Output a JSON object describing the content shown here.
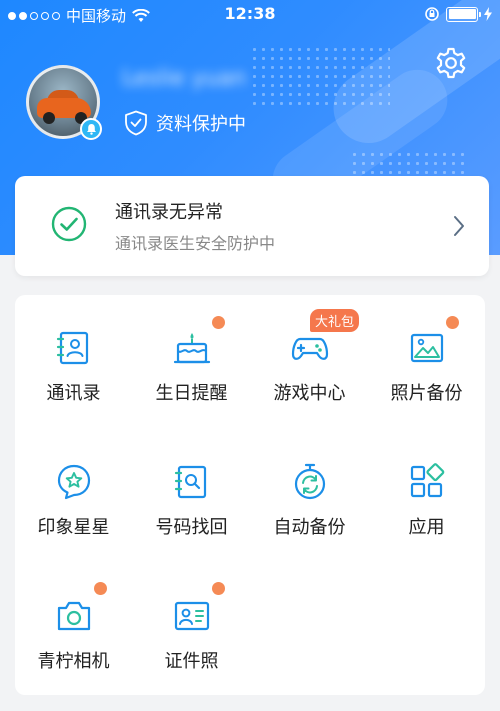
{
  "status_bar": {
    "carrier": "中国移动",
    "time": "12:38"
  },
  "profile": {
    "username": "Leslie yuan",
    "protect_text": "资料保护中"
  },
  "contact_card": {
    "title": "通讯录无异常",
    "subtitle": "通讯录医生安全防护中"
  },
  "grid": {
    "items": [
      {
        "label": "通讯录",
        "icon": "contacts-icon"
      },
      {
        "label": "生日提醒",
        "icon": "birthday-cake-icon",
        "dot": true
      },
      {
        "label": "游戏中心",
        "icon": "gamepad-icon",
        "badge": "大礼包"
      },
      {
        "label": "照片备份",
        "icon": "photo-icon",
        "dot": true
      },
      {
        "label": "印象星星",
        "icon": "star-chat-icon"
      },
      {
        "label": "号码找回",
        "icon": "number-search-icon"
      },
      {
        "label": "自动备份",
        "icon": "auto-backup-icon"
      },
      {
        "label": "应用",
        "icon": "apps-icon"
      },
      {
        "label": "青柠相机",
        "icon": "camera-icon",
        "dot": true
      },
      {
        "label": "证件照",
        "icon": "id-card-icon",
        "dot": true
      }
    ]
  },
  "colors": {
    "accent": "#1e88ff",
    "icon_blue": "#1c8fe8",
    "icon_green": "#2cbfa0",
    "dot": "#f58a55",
    "check_green": "#22b573"
  }
}
